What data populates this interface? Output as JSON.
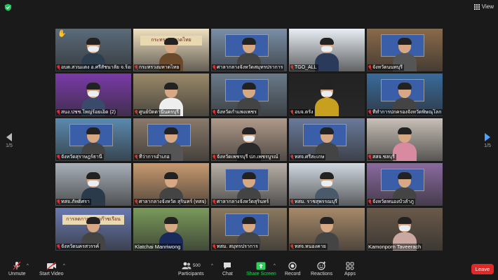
{
  "window": {
    "view_label": "View"
  },
  "pager": {
    "left_page": "1/5",
    "right_page": "1/5"
  },
  "tiles": [
    {
      "label": "อบต.สวนแตง อ.ศรีสัชนาลัย จ.ร้อยเอ็ด",
      "muted": true,
      "bg": "#5a6b7a",
      "body": "#2c3e50",
      "mask": true,
      "hand": true
    },
    {
      "label": "กระทรวงมหาดไทย",
      "muted": true,
      "bg": "#f0e0c0",
      "body": "#6b4a2a",
      "mask": false,
      "banner": "กระทรวงมหาดไทย"
    },
    {
      "label": "ศาลากลางจังหวัดสมุทรปราการ",
      "muted": true,
      "bg": "#7a8fa8",
      "body": "#444",
      "mask": false,
      "screen": true
    },
    {
      "label": "TGO_ALL",
      "muted": true,
      "bg": "#e8eef4",
      "body": "#2a3a5a",
      "mask": true
    },
    {
      "label": "จังหวัดนนทบุรี",
      "muted": true,
      "bg": "#8a6a4a",
      "body": "#555",
      "mask": false,
      "screen": true
    },
    {
      "label": "สนง.ปชช.ใหญ่ร้อยเอ็ด (2)",
      "muted": true,
      "bg": "#7a3aa8",
      "body": "#3a4a6a",
      "mask": true
    },
    {
      "label": "ศูนย์ปัตตานีนครบุรี",
      "muted": true,
      "bg": "#9a8a6a",
      "body": "#eee",
      "mask": false
    },
    {
      "label": "จังหวัดกำแพงเพชร",
      "muted": true,
      "bg": "#6a7a8a",
      "body": "#444",
      "mask": false,
      "screen": true
    },
    {
      "label": "อบจ.ตรัง",
      "muted": true,
      "bg": "#222",
      "body": "#c8a020",
      "mask": true
    },
    {
      "label": "ที่ทำการปกครองจังหวัดพิษณุโลก",
      "muted": true,
      "bg": "#3a6a9a",
      "body": "#444",
      "mask": false,
      "screen": true
    },
    {
      "label": "จังหวัดสุราษฎร์ธานี",
      "muted": true,
      "bg": "#5a8ab0",
      "body": "#444",
      "mask": false,
      "screen": true
    },
    {
      "label": "ที่ว่าการอำเภอ",
      "muted": true,
      "bg": "#8a7a6a",
      "body": "#555",
      "mask": false,
      "screen": true
    },
    {
      "label": "จังหวัดเพชรบุรี ปภ.เพชรบูรณ์",
      "muted": true,
      "bg": "#b09a8a",
      "body": "#2a2a2a",
      "mask": true
    },
    {
      "label": "ทสจ.ศรีสะเกษ",
      "muted": true,
      "bg": "#6a7a9a",
      "body": "#444",
      "mask": false,
      "screen": true
    },
    {
      "label": "สสจ.ชลบุรี",
      "muted": true,
      "bg": "#c8c0b8",
      "body": "#d88aa0",
      "mask": false
    },
    {
      "label": "ทสจ.ภัทติศรา",
      "muted": true,
      "bg": "#a8b0b8",
      "body": "#2a3a4a",
      "mask": true
    },
    {
      "label": "ศาลากลางจังหวัด สุรินทร์ (ทสจ)",
      "muted": true,
      "bg": "#c89a70",
      "body": "#444",
      "mask": false
    },
    {
      "label": "ศาลากลางจังหวัดสุรินทร์",
      "muted": true,
      "bg": "#b8b0a8",
      "body": "#444",
      "mask": false,
      "screen": true
    },
    {
      "label": "ทสม. ราชสุพรรณบุรี",
      "muted": true,
      "bg": "#d0d8e0",
      "body": "#4a5a6a",
      "mask": true
    },
    {
      "label": "จังหวัดหนองบัวลำภู",
      "muted": true,
      "bg": "#8a6aa0",
      "body": "#444",
      "mask": false,
      "screen": true
    },
    {
      "label": "จังหวัดนครสวรรค์",
      "muted": true,
      "bg": "#6a7ab0",
      "body": "#444",
      "mask": false,
      "banner": "การลดการปล่อยก๊าซเรือนกระจก"
    },
    {
      "label": "Klatchai Manriwong",
      "muted": false,
      "plain": true,
      "bg": "#7a9a5a",
      "body": "#1a2a5a",
      "mask": false
    },
    {
      "label": "ทสม. สมุทรปราการ",
      "muted": true,
      "bg": "#8a7a60",
      "body": "#444",
      "mask": false,
      "screen": true
    },
    {
      "label": "ทสจ.หนองคาย",
      "muted": true,
      "bg": "#a88a6a",
      "body": "#444",
      "mask": false
    },
    {
      "label": "Kamonporn Taveerach",
      "muted": false,
      "plain": true,
      "active": true,
      "bg": "#6a5a4a",
      "body": "#c8a8a0",
      "mask": true
    }
  ],
  "toolbar": {
    "unmute": "Unmute",
    "start_video": "Start Video",
    "participants": "Participants",
    "participants_count": "500",
    "chat": "Chat",
    "share_screen": "Share Screen",
    "record": "Record",
    "reactions": "Reactions",
    "apps": "Apps",
    "leave": "Leave"
  }
}
